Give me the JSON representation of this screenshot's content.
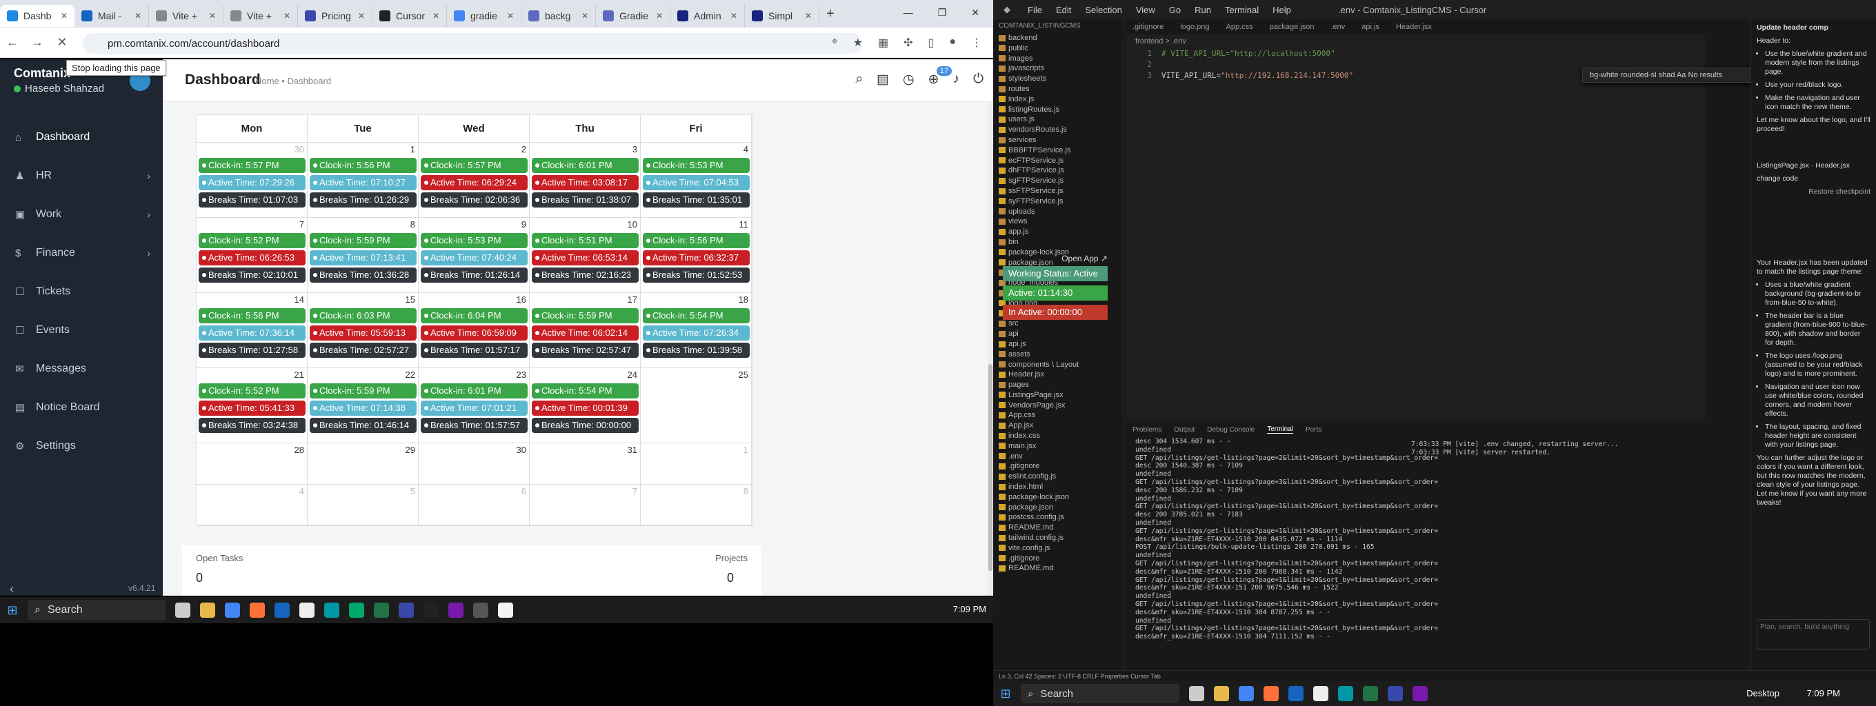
{
  "browser": {
    "tabs": [
      {
        "label": "Dashb",
        "active": true,
        "favicon_color": "#1e88e5"
      },
      {
        "label": "Mail -",
        "active": false,
        "favicon_color": "#1565c0"
      },
      {
        "label": "Vite +",
        "active": false,
        "favicon_color": "#888888"
      },
      {
        "label": "Vite +",
        "active": false,
        "favicon_color": "#888888"
      },
      {
        "label": "Pricing",
        "active": false,
        "favicon_color": "#3949ab"
      },
      {
        "label": "Cursor",
        "active": false,
        "favicon_color": "#222222"
      },
      {
        "label": "gradie",
        "active": false,
        "favicon_color": "#4285f4"
      },
      {
        "label": "backg",
        "active": false,
        "favicon_color": "#5c6bc0"
      },
      {
        "label": "Gradie",
        "active": false,
        "favicon_color": "#5c6bc0"
      },
      {
        "label": "Admin",
        "active": false,
        "favicon_color": "#1a237e"
      },
      {
        "label": "Simpl",
        "active": false,
        "favicon_color": "#1a237e"
      }
    ],
    "url": "pm.comtanix.com/account/dashboard",
    "tooltip": "Stop loading this page"
  },
  "sidebar": {
    "brand": "Comtanix",
    "user": "Haseeb Shahzad",
    "version": "v6.4.21",
    "items": [
      {
        "label": "Dashboard",
        "icon": "⌂",
        "active": true,
        "chevron": false
      },
      {
        "label": "HR",
        "icon": "♟",
        "active": false,
        "chevron": true
      },
      {
        "label": "Work",
        "icon": "▣",
        "active": false,
        "chevron": true
      },
      {
        "label": "Finance",
        "icon": "$",
        "active": false,
        "chevron": true
      },
      {
        "label": "Tickets",
        "icon": "☐",
        "active": false,
        "chevron": false
      },
      {
        "label": "Events",
        "icon": "☐",
        "active": false,
        "chevron": false
      },
      {
        "label": "Messages",
        "icon": "✉",
        "active": false,
        "chevron": false
      },
      {
        "label": "Notice Board",
        "icon": "▤",
        "active": false,
        "chevron": false
      },
      {
        "label": "Settings",
        "icon": "⚙",
        "active": false,
        "chevron": false
      }
    ]
  },
  "header": {
    "title": "Dashboard",
    "breadcrumb": "Home • Dashboard",
    "notification_count": "17"
  },
  "calendar": {
    "days": [
      "Mon",
      "Tue",
      "Wed",
      "Thu",
      "Fri"
    ],
    "weeks": [
      [
        {
          "num": "30",
          "muted": true,
          "events": [
            [
              "green",
              "Clock-in: 5:57 PM"
            ],
            [
              "blue",
              "Active Time: 07:29:26"
            ],
            [
              "dark",
              "Breaks Time: 01:07:03"
            ]
          ]
        },
        {
          "num": "1",
          "muted": false,
          "events": [
            [
              "green",
              "Clock-in: 5:56 PM"
            ],
            [
              "blue",
              "Active Time: 07:10:27"
            ],
            [
              "dark",
              "Breaks Time: 01:26:29"
            ]
          ]
        },
        {
          "num": "2",
          "muted": false,
          "events": [
            [
              "green",
              "Clock-in: 5:57 PM"
            ],
            [
              "red",
              "Active Time: 06:29:24"
            ],
            [
              "dark",
              "Breaks Time: 02:06:36"
            ]
          ]
        },
        {
          "num": "3",
          "muted": false,
          "events": [
            [
              "green",
              "Clock-in: 6:01 PM"
            ],
            [
              "red",
              "Active Time: 03:08:17"
            ],
            [
              "dark",
              "Breaks Time: 01:38:07"
            ]
          ]
        },
        {
          "num": "4",
          "muted": false,
          "events": [
            [
              "green",
              "Clock-in: 5:53 PM"
            ],
            [
              "blue",
              "Active Time: 07:04:53"
            ],
            [
              "dark",
              "Breaks Time: 01:35:01"
            ]
          ]
        }
      ],
      [
        {
          "num": "7",
          "muted": false,
          "events": [
            [
              "green",
              "Clock-in: 5:52 PM"
            ],
            [
              "red",
              "Active Time: 06:26:53"
            ],
            [
              "dark",
              "Breaks Time: 02:10:01"
            ]
          ]
        },
        {
          "num": "8",
          "muted": false,
          "events": [
            [
              "green",
              "Clock-in: 5:59 PM"
            ],
            [
              "blue",
              "Active Time: 07:13:41"
            ],
            [
              "dark",
              "Breaks Time: 01:36:28"
            ]
          ]
        },
        {
          "num": "9",
          "muted": false,
          "events": [
            [
              "green",
              "Clock-in: 5:53 PM"
            ],
            [
              "blue",
              "Active Time: 07:40:24"
            ],
            [
              "dark",
              "Breaks Time: 01:26:14"
            ]
          ]
        },
        {
          "num": "10",
          "muted": false,
          "events": [
            [
              "green",
              "Clock-in: 5:51 PM"
            ],
            [
              "red",
              "Active Time: 06:53:14"
            ],
            [
              "dark",
              "Breaks Time: 02:16:23"
            ]
          ]
        },
        {
          "num": "11",
          "muted": false,
          "events": [
            [
              "green",
              "Clock-in: 5:56 PM"
            ],
            [
              "red",
              "Active Time: 06:32:37"
            ],
            [
              "dark",
              "Breaks Time: 01:52:53"
            ]
          ]
        }
      ],
      [
        {
          "num": "14",
          "muted": false,
          "events": [
            [
              "green",
              "Clock-in: 5:56 PM"
            ],
            [
              "blue",
              "Active Time: 07:36:14"
            ],
            [
              "dark",
              "Breaks Time: 01:27:58"
            ]
          ]
        },
        {
          "num": "15",
          "muted": false,
          "events": [
            [
              "green",
              "Clock-in: 6:03 PM"
            ],
            [
              "red",
              "Active Time: 05:59:13"
            ],
            [
              "dark",
              "Breaks Time: 02:57:27"
            ]
          ]
        },
        {
          "num": "16",
          "muted": false,
          "events": [
            [
              "green",
              "Clock-in: 6:04 PM"
            ],
            [
              "red",
              "Active Time: 06:59:09"
            ],
            [
              "dark",
              "Breaks Time: 01:57:17"
            ]
          ]
        },
        {
          "num": "17",
          "muted": false,
          "events": [
            [
              "green",
              "Clock-in: 5:59 PM"
            ],
            [
              "red",
              "Active Time: 06:02:14"
            ],
            [
              "dark",
              "Breaks Time: 02:57:47"
            ]
          ]
        },
        {
          "num": "18",
          "muted": false,
          "events": [
            [
              "green",
              "Clock-in: 5:54 PM"
            ],
            [
              "blue",
              "Active Time: 07:26:34"
            ],
            [
              "dark",
              "Breaks Time: 01:39:58"
            ]
          ]
        }
      ],
      [
        {
          "num": "21",
          "muted": false,
          "events": [
            [
              "green",
              "Clock-in: 5:52 PM"
            ],
            [
              "red",
              "Active Time: 05:41:33"
            ],
            [
              "dark",
              "Breaks Time: 03:24:38"
            ]
          ]
        },
        {
          "num": "22",
          "muted": false,
          "events": [
            [
              "green",
              "Clock-in: 5:59 PM"
            ],
            [
              "blue",
              "Active Time: 07:14:38"
            ],
            [
              "dark",
              "Breaks Time: 01:46:14"
            ]
          ]
        },
        {
          "num": "23",
          "muted": false,
          "events": [
            [
              "green",
              "Clock-in: 6:01 PM"
            ],
            [
              "blue",
              "Active Time: 07:01:21"
            ],
            [
              "dark",
              "Breaks Time: 01:57:57"
            ]
          ]
        },
        {
          "num": "24",
          "muted": false,
          "events": [
            [
              "green",
              "Clock-in: 5:54 PM"
            ],
            [
              "red",
              "Active Time: 00:01:39"
            ],
            [
              "dark",
              "Breaks Time: 00:00:00"
            ]
          ]
        },
        {
          "num": "25",
          "muted": false,
          "events": []
        }
      ],
      [
        {
          "num": "28",
          "muted": false,
          "events": []
        },
        {
          "num": "29",
          "muted": false,
          "events": []
        },
        {
          "num": "30",
          "muted": false,
          "events": []
        },
        {
          "num": "31",
          "muted": false,
          "events": []
        },
        {
          "num": "1",
          "muted": true,
          "events": []
        }
      ],
      [
        {
          "num": "4",
          "muted": true,
          "events": []
        },
        {
          "num": "5",
          "muted": true,
          "events": []
        },
        {
          "num": "6",
          "muted": true,
          "events": []
        },
        {
          "num": "7",
          "muted": true,
          "events": []
        },
        {
          "num": "8",
          "muted": true,
          "events": []
        }
      ]
    ]
  },
  "tasks": {
    "open_label": "Open Tasks",
    "open_value": "0",
    "projects_label": "Projects",
    "projects_value": "0"
  },
  "left_taskbar": {
    "search": "Search",
    "clock": "7:09 PM"
  },
  "editor": {
    "menus": [
      "File",
      "Edit",
      "Selection",
      "View",
      "Go",
      "Run",
      "Terminal",
      "Help"
    ],
    "title": ".env - Comtanix_ListingCMS - Cursor",
    "explorer_title": "COMTANIX_LISTINGCMS",
    "tree": [
      "backend",
      "public",
      "images",
      "javascripts",
      "stylesheets",
      "routes",
      "index.js",
      "listingRoutes.js",
      "users.js",
      "vendorsRoutes.js",
      "services",
      "BBBFTPService.js",
      "ecFTPService.js",
      "dhFTPService.js",
      "sgFTPService.js",
      "ssFTPService.js",
      "syFTPService.js",
      "uploads",
      "views",
      "app.js",
      "bin",
      "package-lock.json",
      "package.json",
      "frontend",
      "node_modules",
      "public",
      "logo.png",
      "vite.svg",
      "src",
      "api",
      "api.js",
      "assets",
      "components \\ Layout",
      "Header.jsx",
      "pages",
      "ListingsPage.jsx",
      "VendorsPage.jsx",
      "App.css",
      "App.jsx",
      "index.css",
      "main.jsx",
      ".env",
      ".gitignore",
      "eslint.config.js",
      "index.html",
      "package-lock.json",
      "package.json",
      "postcss.config.js",
      "README.md",
      "tailwind.config.js",
      "vite.config.js",
      ".gitignore",
      "README.md"
    ],
    "tabs": [
      ".gitignore",
      "logo.png",
      "App.css",
      "package.json",
      ".env",
      "api.js",
      "Header.jsx"
    ],
    "crumb": "frontend > .env",
    "code": [
      {
        "ln": "1",
        "comment": "# VITE_API_URL=\"http://localhost:5000\"",
        "key": "",
        "str": ""
      },
      {
        "ln": "2",
        "comment": "",
        "key": "",
        "str": ""
      },
      {
        "ln": "3",
        "comment": "",
        "key": "VITE_API_URL=",
        "str": "\"http://192.168.214.147:5000\""
      }
    ],
    "find": "bg-white rounded-sl shad   Aa   No results",
    "overlay": {
      "open": "Open App ↗",
      "status": "Working Status: Active",
      "active": "Active: 01:14:30",
      "inactive": "In Active: 00:00:00"
    },
    "panel_tabs": [
      "Problems",
      "Output",
      "Debug Console",
      "Terminal",
      "Ports"
    ],
    "terminal": [
      "desc 304 1534.607 ms - -",
      "undefined",
      "GET /api/listings/get-listings?page=2&limit=20&sort_by=timestamp&sort_order=",
      "desc 200 1540.387 ms - 7109",
      "undefined",
      "GET /api/listings/get-listings?page=3&limit=20&sort_by=timestamp&sort_order=",
      "desc 200 1586.232 ms - 7109",
      "undefined",
      "GET /api/listings/get-listings?page=1&limit=20&sort_by=timestamp&sort_order=",
      "desc 200 3785.021 ms - 7183",
      "undefined",
      "GET /api/listings/get-listings?page=1&limit=20&sort_by=timestamp&sort_order=",
      "desc&mfr_sku=Z1RE-ET4XXX-1510 200 8435.072 ms - 1114",
      "POST /api/listings/bulk-update-listings 200 270.091 ms - 165",
      "undefined",
      "GET /api/listings/get-listings?page=1&limit=20&sort_by=timestamp&sort_order=",
      "desc&mfr_sku=Z1RE-ET4XXX-1510 200 7988.341 ms - 1142",
      "GET /api/listings/get-listings?page=1&limit=20&sort_by=timestamp&sort_order=",
      "desc&mfr_sku=Z1RE-ET4XXX-151 200 9675.546 ms - 1522",
      "undefined",
      "GET /api/listings/get-listings?page=1&limit=20&sort_by=timestamp&sort_order=",
      "desc&mfr_sku=Z1RE-ET4XXX-1510 304 8787.255 ms - -",
      "undefined",
      "GET /api/listings/get-listings?page=1&limit=20&sort_by=timestamp&sort_order=",
      "desc&mfr_sku=Z1RE-ET4XXX-1510 304 7111.152 ms - -"
    ],
    "terminal_right": [
      "7:03:33 PM [vite] .env changed, restarting server...",
      "7:03:33 PM [vite] server restarted."
    ],
    "chat": {
      "title": "Update header comp",
      "intro": "Header to:",
      "bullets1": [
        "Use the blue/white gradient and modern style from the listings page.",
        "Use your red/black logo.",
        "Make the navigation and user icon match the new theme."
      ],
      "ask": "Let me know about the logo, and I'll proceed!",
      "files": [
        "ListingsPage.jsx",
        "Header.jsx"
      ],
      "change": "change code",
      "restore": "Restore checkpoint",
      "summary": "Your Header.jsx has been updated to match the listings page theme:",
      "bullets2": [
        "Uses a blue/white gradient background (bg-gradient-to-br from-blue-50 to-white).",
        "The header bar is a blue gradient (from-blue-900 to-blue-800), with shadow and border for depth.",
        "The logo uses /logo.png (assumed to be your red/black logo) and is more prominent.",
        "Navigation and user icon now use white/blue colors, rounded corners, and modern hover effects.",
        "The layout, spacing, and fixed header height are consistent with your listings page."
      ],
      "outro": "You can further adjust the logo or colors if you want a different look, but this now matches the modern, clean style of your listings page. Let me know if you want any more tweaks!",
      "input_placeholder": "Plan, search, build anything"
    },
    "status": "Ln 3, Col 42   Spaces: 2   UTF-8   CRLF   Properties   Cursor Tab",
    "taskbar_search": "Search",
    "desktop": "Desktop",
    "clock": "7:09 PM"
  },
  "colors": {
    "green": "#3aa547",
    "blue": "#5bb8cf",
    "red": "#c91f24",
    "dark": "#33373d",
    "sidebar": "#1e2632"
  }
}
